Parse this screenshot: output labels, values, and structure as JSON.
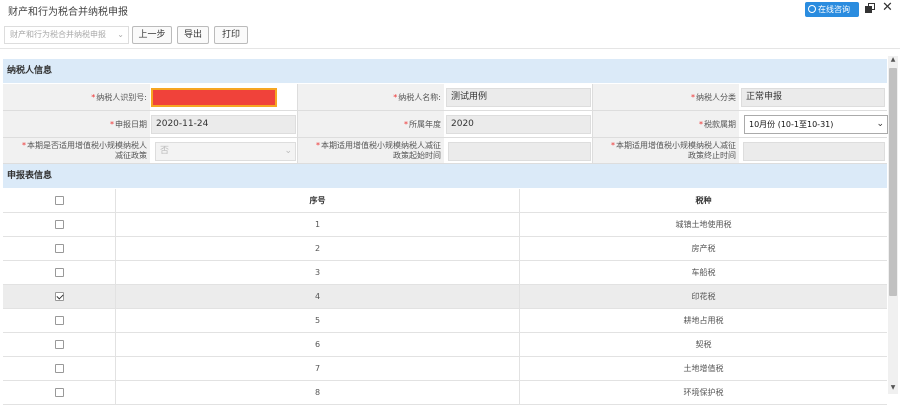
{
  "window": {
    "title": "财产和行为税合并纳税申报"
  },
  "titlebar": {
    "online_consult": "在线咨询",
    "close": "✕"
  },
  "toolbar": {
    "select_value": "财产和行为税合并纳税申报",
    "prev_label": "上一步",
    "export_label": "导出",
    "print_label": "打印"
  },
  "taxpayer_section": {
    "title": "纳税人信息",
    "fields": {
      "taxpayer_id_label": "纳税人识别号:",
      "taxpayer_name_label": "纳税人名称:",
      "taxpayer_name_value": "测试用例",
      "taxpayer_type_label": "纳税人分类",
      "taxpayer_type_value": "正常申报",
      "report_date_label": "申报日期",
      "report_date_value": "2020-11-24",
      "year_label": "所属年度",
      "year_value": "2020",
      "period_label": "税款属期",
      "period_value": "10月份 (10-1至10-31)",
      "reduction_policy_label_1": "本期是否适用增值税小规模纳税人",
      "reduction_policy_label_2": "减征政策",
      "reduction_policy_value": "否",
      "reduction_start_label_1": "本期适用增值税小规模纳税人减征",
      "reduction_start_label_2": "政策起始时间",
      "reduction_end_label_1": "本期适用增值税小规模纳税人减征",
      "reduction_end_label_2": "政策终止时间",
      "required_mark": "*"
    }
  },
  "declaration_section": {
    "title": "申报表信息",
    "columns": {
      "seq": "序号",
      "tax_type": "税种"
    },
    "rows": [
      {
        "seq": "1",
        "tax_type": "城镇土地使用税",
        "checked": false
      },
      {
        "seq": "2",
        "tax_type": "房产税",
        "checked": false
      },
      {
        "seq": "3",
        "tax_type": "车船税",
        "checked": false
      },
      {
        "seq": "4",
        "tax_type": "印花税",
        "checked": true
      },
      {
        "seq": "5",
        "tax_type": "耕地占用税",
        "checked": false
      },
      {
        "seq": "6",
        "tax_type": "契税",
        "checked": false
      },
      {
        "seq": "7",
        "tax_type": "土地增值税",
        "checked": false
      },
      {
        "seq": "8",
        "tax_type": "环境保护税",
        "checked": false
      }
    ]
  },
  "colors": {
    "accent": "#2a8cdf",
    "section_bg": "#dbeaf8",
    "highlight_red": "#f0423a"
  }
}
